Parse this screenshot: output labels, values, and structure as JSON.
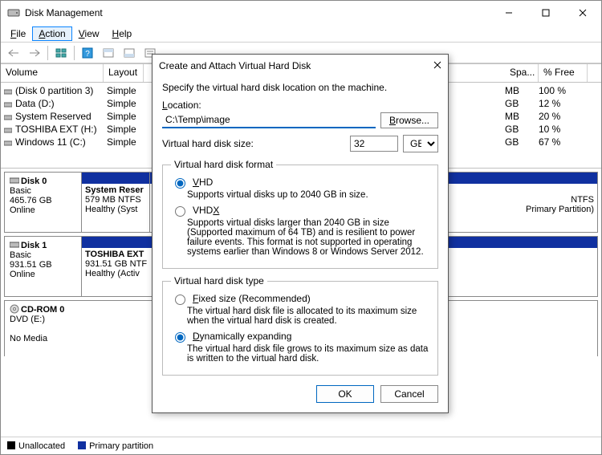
{
  "window": {
    "title": "Disk Management",
    "menu": {
      "file": "File",
      "action": "Action",
      "view": "View",
      "help": "Help"
    }
  },
  "columns": {
    "volume": "Volume",
    "layout": "Layout",
    "spa": "Spa...",
    "free": "% Free"
  },
  "col_widths": {
    "volume": 128,
    "layout": 50,
    "spa": 38,
    "free": 60
  },
  "volumes": [
    {
      "name": "(Disk 0 partition 3)",
      "layout": "Simple",
      "spa": "MB",
      "free": "100 %"
    },
    {
      "name": "Data (D:)",
      "layout": "Simple",
      "spa": "GB",
      "free": "12 %"
    },
    {
      "name": "System Reserved",
      "layout": "Simple",
      "spa": "MB",
      "free": "20 %"
    },
    {
      "name": "TOSHIBA EXT (H:)",
      "layout": "Simple",
      "spa": "GB",
      "free": "10 %"
    },
    {
      "name": "Windows 11 (C:)",
      "layout": "Simple",
      "spa": "GB",
      "free": "67 %"
    }
  ],
  "disks": {
    "d0": {
      "name": "Disk 0",
      "type": "Basic",
      "size": "465.76 GB",
      "status": "Online",
      "p0": {
        "title": "System Reser",
        "l2": "579 MB NTFS",
        "l3": "Healthy (Syst"
      },
      "p1": {
        "title": "",
        "l2": "NTFS",
        "l3": "Primary Partition)"
      }
    },
    "d1": {
      "name": "Disk 1",
      "type": "Basic",
      "size": "931.51 GB",
      "status": "Online",
      "p0": {
        "title": "TOSHIBA EXT",
        "l2": "931.51 GB NTF",
        "l3": "Healthy (Activ"
      }
    },
    "cd": {
      "name": "CD-ROM 0",
      "type": "DVD (E:)",
      "status": "No Media"
    }
  },
  "legend": {
    "unalloc": "Unallocated",
    "primary": "Primary partition"
  },
  "dialog": {
    "title": "Create and Attach Virtual Hard Disk",
    "intro": "Specify the virtual hard disk location on the machine.",
    "location_label": "Location:",
    "location_value": "C:\\Temp\\image",
    "browse": "Browse...",
    "size_label": "Virtual hard disk size:",
    "size_value": "32",
    "size_unit": "GB",
    "fmt_legend": "Virtual hard disk format",
    "fmt_vhd": "VHD",
    "fmt_vhd_desc": "Supports virtual disks up to 2040 GB in size.",
    "fmt_vhdx": "VHDX",
    "fmt_vhdx_desc": "Supports virtual disks larger than 2040 GB in size (Supported maximum of 64 TB) and is resilient to power failure events. This format is not supported in operating systems earlier than Windows 8 or Windows Server 2012.",
    "type_legend": "Virtual hard disk type",
    "type_fixed": "Fixed size (Recommended)",
    "type_fixed_desc": "The virtual hard disk file is allocated to its maximum size when the virtual hard disk is created.",
    "type_dyn": "Dynamically expanding",
    "type_dyn_desc": "The virtual hard disk file grows to its maximum size as data is written to the virtual hard disk.",
    "ok": "OK",
    "cancel": "Cancel"
  }
}
